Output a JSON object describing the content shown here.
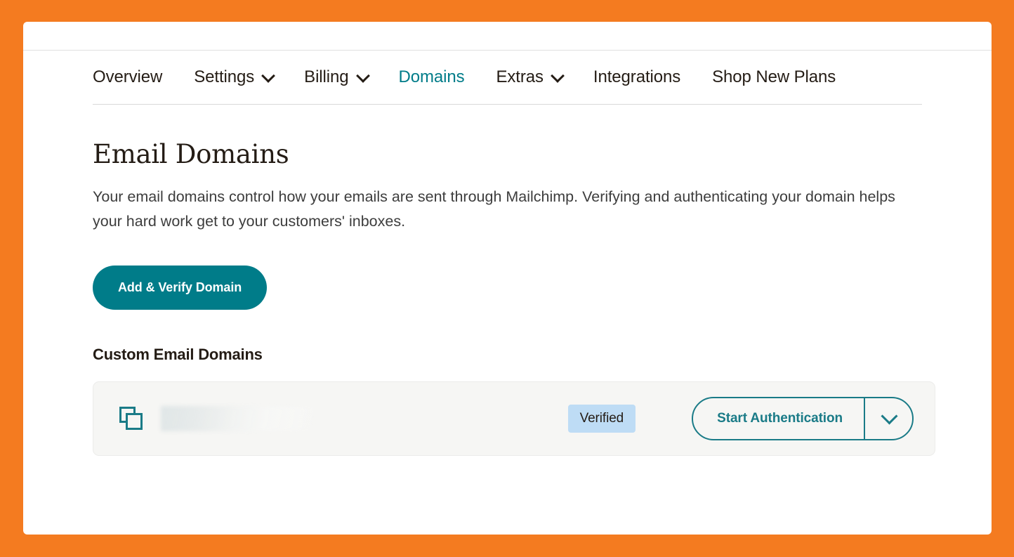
{
  "theme": {
    "page_background": "#f47b20",
    "card_background": "#ffffff",
    "accent_teal": "#007c89",
    "link_teal": "#1a7b87",
    "badge_background": "#bedcf5",
    "row_background": "#f6f6f4",
    "text_primary": "#241c15"
  },
  "nav": {
    "tabs": [
      {
        "label": "Overview",
        "has_caret": false,
        "active": false
      },
      {
        "label": "Settings",
        "has_caret": true,
        "active": false
      },
      {
        "label": "Billing",
        "has_caret": true,
        "active": false
      },
      {
        "label": "Domains",
        "has_caret": false,
        "active": true
      },
      {
        "label": "Extras",
        "has_caret": true,
        "active": false
      },
      {
        "label": "Integrations",
        "has_caret": false,
        "active": false
      },
      {
        "label": "Shop New Plans",
        "has_caret": false,
        "active": false
      }
    ]
  },
  "main": {
    "title": "Email Domains",
    "description": "Your email domains control how your emails are sent through Mailchimp. Verifying and authenticating your domain helps your hard work get to your customers' inboxes.",
    "add_verify_button": "Add & Verify Domain",
    "section_label": "Custom Email Domains"
  },
  "domain_row": {
    "copy_icon": "copy-icon",
    "domain_name": "",
    "domain_name_redacted": true,
    "status_badge": "Verified",
    "primary_action": "Start Authentication",
    "dropdown_icon": "chevron-down-icon"
  }
}
